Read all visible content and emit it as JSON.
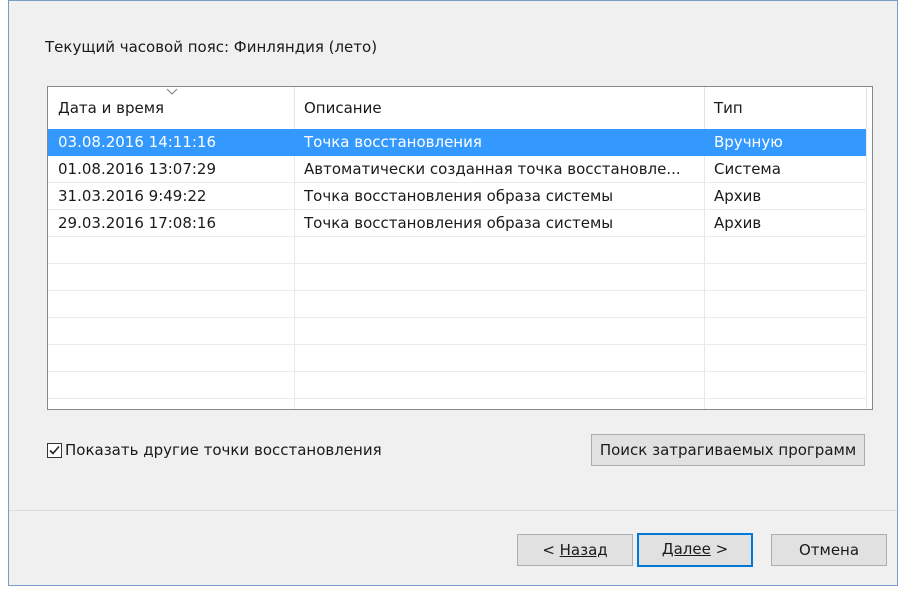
{
  "timezone_label": "Текущий часовой пояс: Финляндия (лето)",
  "table": {
    "columns": [
      "Дата и время",
      "Описание",
      "Тип"
    ],
    "rows": [
      {
        "date": "03.08.2016 14:11:16",
        "desc": "Точка восстановления",
        "type": "Вручную",
        "selected": true
      },
      {
        "date": "01.08.2016 13:07:29",
        "desc": "Автоматически созданная точка восстановле...",
        "type": "Система",
        "selected": false
      },
      {
        "date": "31.03.2016 9:49:22",
        "desc": "Точка восстановления образа системы",
        "type": "Архив",
        "selected": false
      },
      {
        "date": "29.03.2016 17:08:16",
        "desc": "Точка восстановления образа системы",
        "type": "Архив",
        "selected": false
      }
    ]
  },
  "show_more": {
    "label": "Показать другие точки восстановления",
    "checked": true
  },
  "buttons": {
    "scan": "Поиск затрагиваемых программ",
    "back_prefix": "< ",
    "back": "Назад",
    "next": "Далее",
    "next_suffix": " >",
    "cancel": "Отмена"
  },
  "colors": {
    "selection": "#3399ff",
    "default_button_border": "#0078d7"
  }
}
